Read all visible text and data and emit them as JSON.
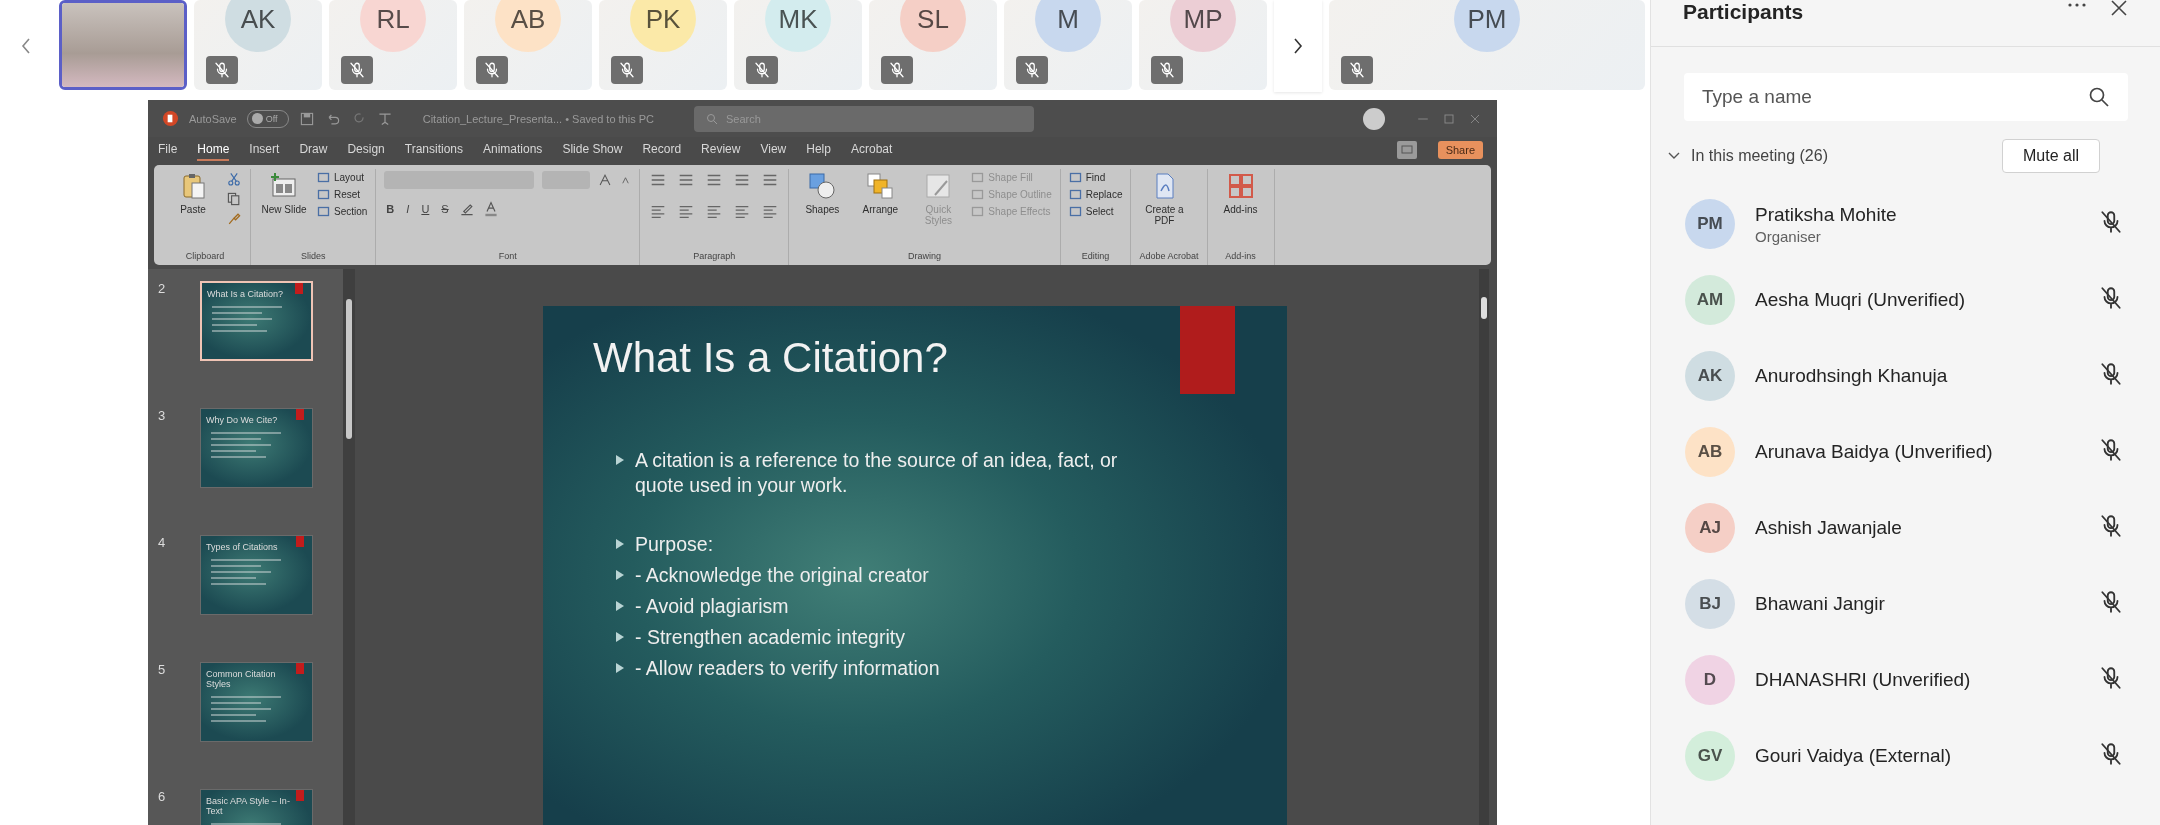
{
  "call_strip": {
    "tiles": [
      {
        "kind": "video",
        "selected": true,
        "muted": false
      },
      {
        "kind": "avatar",
        "initials": "AK",
        "color": "#cfdde2",
        "muted": true,
        "selected": false
      },
      {
        "kind": "avatar",
        "initials": "RL",
        "color": "#f8d6d2",
        "muted": true,
        "selected": false
      },
      {
        "kind": "avatar",
        "initials": "AB",
        "color": "#fde2c6",
        "muted": true,
        "selected": false
      },
      {
        "kind": "avatar",
        "initials": "PK",
        "color": "#fbe9a8",
        "muted": true,
        "selected": false
      },
      {
        "kind": "avatar",
        "initials": "MK",
        "color": "#d3ecee",
        "muted": true,
        "selected": false
      },
      {
        "kind": "avatar",
        "initials": "SL",
        "color": "#f5cfc6",
        "muted": true,
        "selected": false
      },
      {
        "kind": "avatar",
        "initials": "M",
        "color": "#c8d8ee",
        "muted": true,
        "selected": false
      },
      {
        "kind": "avatar",
        "initials": "MP",
        "color": "#ecced5",
        "muted": true,
        "selected": false
      },
      {
        "kind": "avatar",
        "initials": "PM",
        "color": "#c8d8ee",
        "muted": true,
        "selected": false
      }
    ]
  },
  "powerpoint": {
    "title_bar": {
      "autosave_label": "AutoSave",
      "autosave_state": "Off",
      "autosave_on": false,
      "document": "Citation_Lecture_Presenta... • Saved to this PC",
      "search_placeholder": "Search"
    },
    "tabs": [
      {
        "label": "File",
        "selected": false
      },
      {
        "label": "Home",
        "selected": true
      },
      {
        "label": "Insert",
        "selected": false
      },
      {
        "label": "Draw",
        "selected": false
      },
      {
        "label": "Design",
        "selected": false
      },
      {
        "label": "Transitions",
        "selected": false
      },
      {
        "label": "Animations",
        "selected": false
      },
      {
        "label": "Slide Show",
        "selected": false
      },
      {
        "label": "Record",
        "selected": false
      },
      {
        "label": "Review",
        "selected": false
      },
      {
        "label": "View",
        "selected": false
      },
      {
        "label": "Help",
        "selected": false
      },
      {
        "label": "Acrobat",
        "selected": false
      }
    ],
    "share_button": "Share",
    "ribbon": {
      "groups": [
        {
          "kind": "clipboard",
          "name": "Clipboard",
          "large": [
            {
              "label": "Paste",
              "disabled": false
            }
          ]
        },
        {
          "kind": "slides",
          "name": "Slides",
          "large": [
            {
              "label": "New Slide",
              "disabled": false
            }
          ],
          "commands": [
            {
              "label": "Layout",
              "disabled": false
            },
            {
              "label": "Reset",
              "disabled": false
            },
            {
              "label": "Section",
              "disabled": false
            }
          ]
        },
        {
          "kind": "font",
          "name": "Font",
          "format_buttons": [
            "B",
            "I",
            "U",
            "S"
          ]
        },
        {
          "kind": "paragraph",
          "name": "Paragraph"
        },
        {
          "kind": "drawing",
          "name": "Drawing",
          "large": [
            {
              "label": "Shapes",
              "disabled": false
            },
            {
              "label": "Arrange",
              "disabled": false
            },
            {
              "label": "Quick Styles",
              "disabled": true
            }
          ],
          "commands": [
            {
              "label": "Shape Fill",
              "disabled": true
            },
            {
              "label": "Shape Outline",
              "disabled": true
            },
            {
              "label": "Shape Effects",
              "disabled": true
            }
          ]
        },
        {
          "kind": "editing",
          "name": "Editing",
          "commands": [
            {
              "label": "Find",
              "disabled": false
            },
            {
              "label": "Replace",
              "disabled": false
            },
            {
              "label": "Select",
              "disabled": false
            }
          ]
        },
        {
          "kind": "acrobat",
          "name": "Adobe Acrobat",
          "large": [
            {
              "label": "Create a PDF",
              "disabled": false
            }
          ]
        },
        {
          "kind": "addins",
          "name": "Add-ins",
          "large": [
            {
              "label": "Add-ins",
              "disabled": false
            }
          ]
        }
      ]
    },
    "thumbnails": [
      {
        "number": "2",
        "title": "What Is a Citation?",
        "selected": true
      },
      {
        "number": "3",
        "title": "Why Do We Cite?",
        "selected": false
      },
      {
        "number": "4",
        "title": "Types of Citations",
        "selected": false
      },
      {
        "number": "5",
        "title": "Common Citation Styles",
        "selected": false
      },
      {
        "number": "6",
        "title": "Basic APA Style – In-Text",
        "selected": false
      }
    ],
    "slide": {
      "title": "What Is a Citation?",
      "bullets": [
        "A citation is a reference to the source of an idea, fact, or quote used in your work.",
        "Purpose:",
        "- Acknowledge the original creator",
        "- Avoid plagiarism",
        "- Strengthen academic integrity",
        "- Allow readers to verify information"
      ]
    }
  },
  "participants_panel": {
    "title": "Participants",
    "search": {
      "placeholder": "Type a name"
    },
    "section": {
      "label": "In this meeting (26)",
      "expanded": true
    },
    "mute_all_button": "Mute all",
    "people": [
      {
        "initials": "PM",
        "color": "#c8d8ee",
        "name": "Pratiksha Mohite",
        "role": "Organiser",
        "muted": true
      },
      {
        "initials": "AM",
        "color": "#d3eadb",
        "name": "Aesha Muqri (Unverified)",
        "muted": true
      },
      {
        "initials": "AK",
        "color": "#cfdde2",
        "name": "Anurodhsingh Khanuja",
        "muted": true
      },
      {
        "initials": "AB",
        "color": "#fde2c6",
        "name": "Arunava Baidya (Unverified)",
        "muted": true
      },
      {
        "initials": "AJ",
        "color": "#f5cfc6",
        "name": "Ashish Jawanjale",
        "muted": true
      },
      {
        "initials": "BJ",
        "color": "#d4dee6",
        "name": "Bhawani Jangir",
        "muted": true
      },
      {
        "initials": "D",
        "color": "#f0d3e4",
        "name": "DHANASHRI (Unverified)",
        "muted": true
      },
      {
        "initials": "GV",
        "color": "#d3eedb",
        "name": "Gouri Vaidya (External)",
        "muted": true
      }
    ]
  }
}
